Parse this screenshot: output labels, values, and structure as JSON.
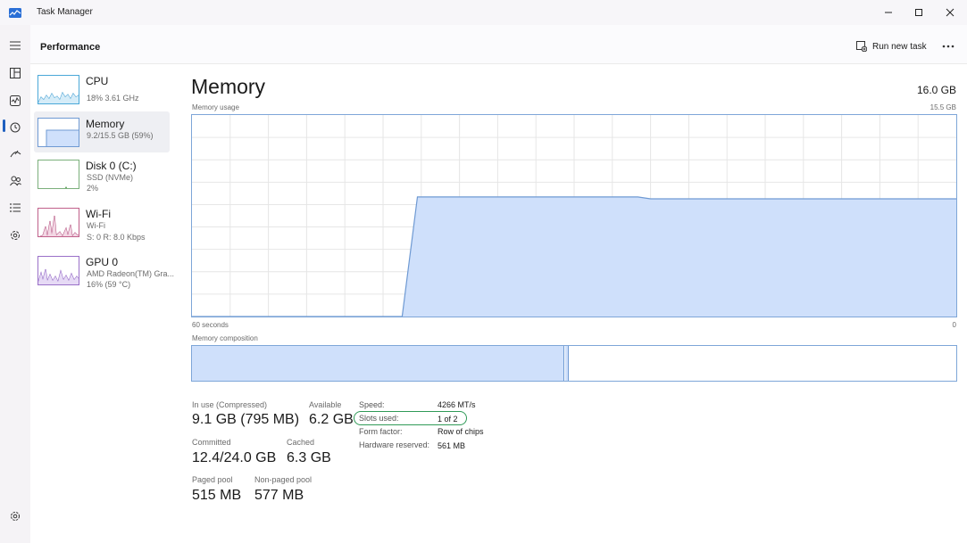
{
  "window": {
    "title": "Task Manager",
    "icons": [
      "app-icon",
      "minimize-icon",
      "maximize-icon",
      "close-icon"
    ]
  },
  "rail": {
    "icons": [
      "hamburger-menu-icon",
      "processes-icon",
      "performance-icon",
      "app-history-icon",
      "startup-apps-icon",
      "users-icon",
      "details-icon",
      "services-icon",
      "settings-icon"
    ],
    "active": "performance-icon"
  },
  "header": {
    "title": "Performance",
    "run_new_task": "Run new task",
    "more_icon": "more-options-icon"
  },
  "devices": [
    {
      "name": "CPU",
      "sub1": "18%  3.61 GHz",
      "sub2": "",
      "sub3": ""
    },
    {
      "name": "Memory",
      "sub1": "9.2/15.5 GB (59%)",
      "sub2": "",
      "sub3": ""
    },
    {
      "name": "Disk 0 (C:)",
      "sub1": "SSD (NVMe)",
      "sub2": "2%",
      "sub3": ""
    },
    {
      "name": "Wi-Fi",
      "sub1": "Wi-Fi",
      "sub2": "S: 0  R: 8.0 Kbps",
      "sub3": ""
    },
    {
      "name": "GPU 0",
      "sub1": "AMD Radeon(TM) Gra...",
      "sub2": "16%  (59 °C)",
      "sub3": ""
    }
  ],
  "main": {
    "title": "Memory",
    "total": "16.0 GB",
    "usage_label": "Memory usage",
    "usage_max": "15.5 GB",
    "time_left": "60 seconds",
    "time_right": "0",
    "composition_label": "Memory composition"
  },
  "chart_data": {
    "type": "area",
    "title": "Memory usage",
    "xlabel": "",
    "ylabel": "",
    "x_range_label": [
      "60 seconds",
      "0"
    ],
    "ylim": [
      0,
      15.5
    ],
    "x": [
      60,
      43.5,
      42.3,
      35,
      25,
      24,
      20,
      10,
      0
    ],
    "values": [
      0,
      0,
      9.2,
      9.2,
      9.2,
      9.05,
      9.05,
      9.05,
      9.05
    ],
    "color": "#cfe0fb",
    "line_color": "#6f9ad3",
    "grid": true
  },
  "composition": {
    "in_use_fraction": 0.487,
    "modified_fraction": 0.005,
    "standby_fraction": 0.0,
    "free_fraction": 0.508
  },
  "stats": {
    "in_use_label": "In use (Compressed)",
    "in_use_value": "9.1 GB (795 MB)",
    "available_label": "Available",
    "available_value": "6.2 GB",
    "committed_label": "Committed",
    "committed_value": "12.4/24.0 GB",
    "cached_label": "Cached",
    "cached_value": "6.3 GB",
    "paged_label": "Paged pool",
    "paged_value": "515 MB",
    "nonpaged_label": "Non-paged pool",
    "nonpaged_value": "577 MB"
  },
  "specs": {
    "speed_label": "Speed:",
    "speed_value": "4266 MT/s",
    "slots_label": "Slots used:",
    "slots_value": "1 of 2",
    "form_label": "Form factor:",
    "form_value": "Row of chips",
    "reserved_label": "Hardware reserved:",
    "reserved_value": "561 MB"
  },
  "colors": {
    "accent": "#1f5fbf",
    "memory_fill": "#cfe0fb",
    "memory_line": "#6f9ad3",
    "highlight_ring": "#2f9a57"
  }
}
